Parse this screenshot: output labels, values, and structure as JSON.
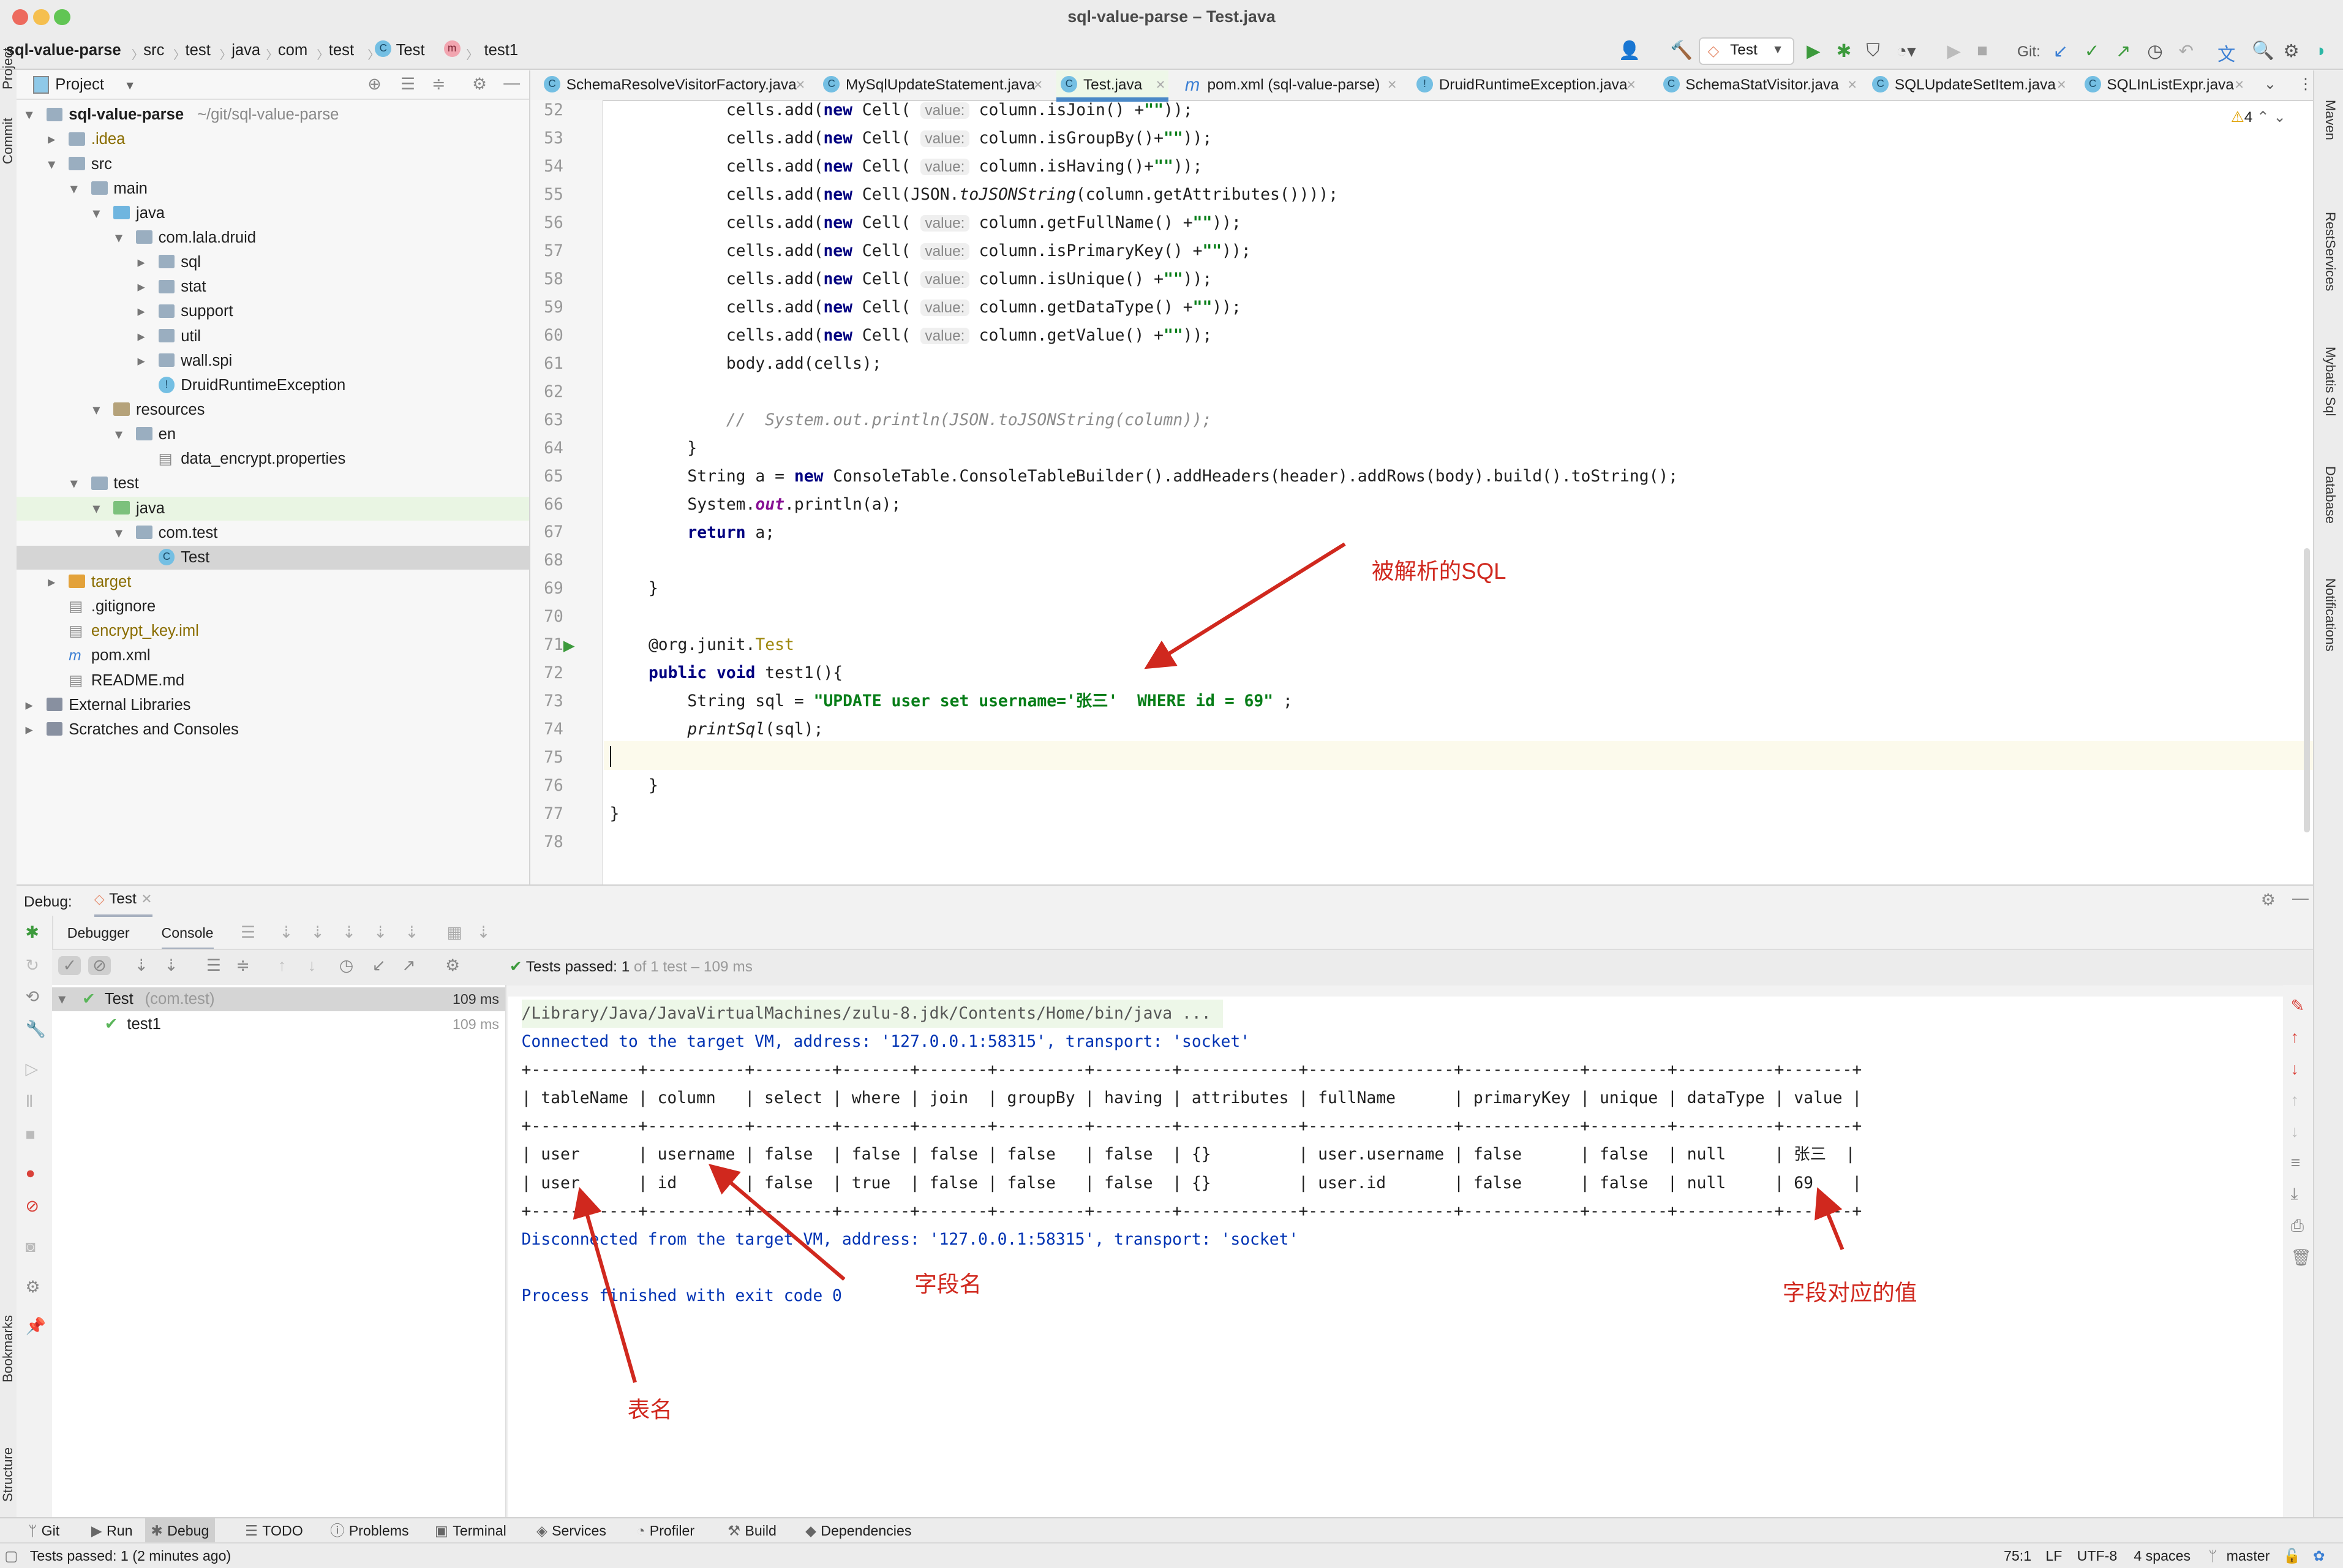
{
  "window": {
    "title": "sql-value-parse – Test.java"
  },
  "breadcrumb": [
    "sql-value-parse",
    "src",
    "test",
    "java",
    "com",
    "test",
    "Test",
    "test1"
  ],
  "toolbar": {
    "run_config": "Test",
    "git_label": "Git:",
    "icons": [
      "user-icon",
      "hammer-icon",
      "run-icon",
      "debug-icon",
      "coverage-icon",
      "profile-icon",
      "resume-icon",
      "stop-icon",
      "git-update-icon",
      "git-commit-icon",
      "git-push-icon",
      "history-icon",
      "rollback-icon",
      "translate-icon",
      "search-icon",
      "gear-icon",
      "toolbox-icon"
    ]
  },
  "left_strip": [
    "Project",
    "Commit",
    "Bookmarks",
    "Structure"
  ],
  "right_strip": [
    "Maven",
    "RestServices",
    "Mybatis Sql",
    "Database",
    "Notifications"
  ],
  "project": {
    "header": "Project",
    "tree": [
      {
        "label": "sql-value-parse",
        "extra": "~/git/sql-value-parse",
        "level": 0,
        "arrow": "open",
        "type": "module"
      },
      {
        "label": ".idea",
        "level": 1,
        "arrow": "closed",
        "type": "folder",
        "color": "#8a6d00"
      },
      {
        "label": "src",
        "level": 1,
        "arrow": "open",
        "type": "folder"
      },
      {
        "label": "main",
        "level": 2,
        "arrow": "open",
        "type": "folder"
      },
      {
        "label": "java",
        "level": 3,
        "arrow": "open",
        "type": "src"
      },
      {
        "label": "com.lala.druid",
        "level": 4,
        "arrow": "open",
        "type": "folder"
      },
      {
        "label": "sql",
        "level": 5,
        "arrow": "closed",
        "type": "folder"
      },
      {
        "label": "stat",
        "level": 5,
        "arrow": "closed",
        "type": "folder"
      },
      {
        "label": "support",
        "level": 5,
        "arrow": "closed",
        "type": "folder"
      },
      {
        "label": "util",
        "level": 5,
        "arrow": "closed",
        "type": "folder"
      },
      {
        "label": "wall.spi",
        "level": 5,
        "arrow": "closed",
        "type": "folder"
      },
      {
        "label": "DruidRuntimeException",
        "level": 5,
        "arrow": "none",
        "type": "exception"
      },
      {
        "label": "resources",
        "level": 3,
        "arrow": "open",
        "type": "res"
      },
      {
        "label": "en",
        "level": 4,
        "arrow": "open",
        "type": "folder"
      },
      {
        "label": "data_encrypt.properties",
        "level": 5,
        "arrow": "none",
        "type": "file"
      },
      {
        "label": "test",
        "level": 2,
        "arrow": "open",
        "type": "folder"
      },
      {
        "label": "java",
        "level": 3,
        "arrow": "open",
        "type": "testsrc",
        "state": "green"
      },
      {
        "label": "com.test",
        "level": 4,
        "arrow": "open",
        "type": "folder"
      },
      {
        "label": "Test",
        "level": 5,
        "arrow": "none",
        "type": "class",
        "state": "selected"
      },
      {
        "label": "target",
        "level": 1,
        "arrow": "closed",
        "type": "excluded",
        "color": "#8a6d00"
      },
      {
        "label": ".gitignore",
        "level": 1,
        "arrow": "none",
        "type": "file"
      },
      {
        "label": "encrypt_key.iml",
        "level": 1,
        "arrow": "none",
        "type": "file",
        "color": "#8a6d00"
      },
      {
        "label": "pom.xml",
        "level": 1,
        "arrow": "none",
        "type": "maven"
      },
      {
        "label": "README.md",
        "level": 1,
        "arrow": "none",
        "type": "md"
      },
      {
        "label": "External Libraries",
        "level": 0,
        "arrow": "closed",
        "type": "lib"
      },
      {
        "label": "Scratches and Consoles",
        "level": 0,
        "arrow": "closed",
        "type": "scratch"
      }
    ]
  },
  "editor": {
    "tabs": [
      {
        "label": "SchemaResolveVisitorFactory.java",
        "icon": "C"
      },
      {
        "label": "MySqlUpdateStatement.java",
        "icon": "C"
      },
      {
        "label": "Test.java",
        "icon": "C",
        "active": true
      },
      {
        "label": "pom.xml (sql-value-parse)",
        "icon": "m"
      },
      {
        "label": "DruidRuntimeException.java",
        "icon": "!"
      },
      {
        "label": "SchemaStatVisitor.java",
        "icon": "C"
      },
      {
        "label": "SQLUpdateSetItem.java",
        "icon": "C"
      },
      {
        "label": "SQLInListExpr.java",
        "icon": "C"
      }
    ],
    "warnings": "4",
    "first_line": 52,
    "current_line": 75,
    "lines": [
      [
        [
          "p",
          "            cells.add("
        ],
        [
          "kw",
          "new"
        ],
        [
          "p",
          " Cell( "
        ],
        [
          "hint",
          "value:"
        ],
        [
          "p",
          " column.isJoin() +"
        ],
        [
          "str",
          "\"\""
        ],
        [
          "p",
          "));"
        ]
      ],
      [
        [
          "p",
          "            cells.add("
        ],
        [
          "kw",
          "new"
        ],
        [
          "p",
          " Cell( "
        ],
        [
          "hint",
          "value:"
        ],
        [
          "p",
          " column.isGroupBy()+"
        ],
        [
          "str",
          "\"\""
        ],
        [
          "p",
          "));"
        ]
      ],
      [
        [
          "p",
          "            cells.add("
        ],
        [
          "kw",
          "new"
        ],
        [
          "p",
          " Cell( "
        ],
        [
          "hint",
          "value:"
        ],
        [
          "p",
          " column.isHaving()+"
        ],
        [
          "str",
          "\"\""
        ],
        [
          "p",
          "));"
        ]
      ],
      [
        [
          "p",
          "            cells.add("
        ],
        [
          "kw",
          "new"
        ],
        [
          "p",
          " Cell(JSON."
        ],
        [
          "it",
          "toJSONString"
        ],
        [
          "p",
          "(column.getAttributes())));"
        ]
      ],
      [
        [
          "p",
          "            cells.add("
        ],
        [
          "kw",
          "new"
        ],
        [
          "p",
          " Cell( "
        ],
        [
          "hint",
          "value:"
        ],
        [
          "p",
          " column.getFullName() +"
        ],
        [
          "str",
          "\"\""
        ],
        [
          "p",
          "));"
        ]
      ],
      [
        [
          "p",
          "            cells.add("
        ],
        [
          "kw",
          "new"
        ],
        [
          "p",
          " Cell( "
        ],
        [
          "hint",
          "value:"
        ],
        [
          "p",
          " column.isPrimaryKey() +"
        ],
        [
          "str",
          "\"\""
        ],
        [
          "p",
          "));"
        ]
      ],
      [
        [
          "p",
          "            cells.add("
        ],
        [
          "kw",
          "new"
        ],
        [
          "p",
          " Cell( "
        ],
        [
          "hint",
          "value:"
        ],
        [
          "p",
          " column.isUnique() +"
        ],
        [
          "str",
          "\"\""
        ],
        [
          "p",
          "));"
        ]
      ],
      [
        [
          "p",
          "            cells.add("
        ],
        [
          "kw",
          "new"
        ],
        [
          "p",
          " Cell( "
        ],
        [
          "hint",
          "value:"
        ],
        [
          "p",
          " column.getDataType() +"
        ],
        [
          "str",
          "\"\""
        ],
        [
          "p",
          "));"
        ]
      ],
      [
        [
          "p",
          "            cells.add("
        ],
        [
          "kw",
          "new"
        ],
        [
          "p",
          " Cell( "
        ],
        [
          "hint",
          "value:"
        ],
        [
          "p",
          " column.getValue() +"
        ],
        [
          "str",
          "\"\""
        ],
        [
          "p",
          "));"
        ]
      ],
      [
        [
          "p",
          "            body.add(cells);"
        ]
      ],
      [],
      [
        [
          "cm",
          "            //  System.out.println(JSON.toJSONString(column));"
        ]
      ],
      [
        [
          "p",
          "        }"
        ]
      ],
      [
        [
          "p",
          "        String a = "
        ],
        [
          "kw",
          "new"
        ],
        [
          "p",
          " ConsoleTable.ConsoleTableBuilder().addHeaders(header).addRows(body).build().toString();"
        ]
      ],
      [
        [
          "p",
          "        System."
        ],
        [
          "fld",
          "out"
        ],
        [
          "p",
          ".println(a);"
        ]
      ],
      [
        [
          "p",
          "        "
        ],
        [
          "kw",
          "return"
        ],
        [
          "p",
          " a;"
        ]
      ],
      [],
      [
        [
          "p",
          "    }"
        ]
      ],
      [],
      [
        [
          "p",
          "    @org.junit."
        ],
        [
          "ann",
          "Test"
        ]
      ],
      [
        [
          "p",
          "    "
        ],
        [
          "kw",
          "public void"
        ],
        [
          "p",
          " test1(){"
        ]
      ],
      [
        [
          "p",
          "        String sql = "
        ],
        [
          "str",
          "\"UPDATE user set username='张三'  WHERE id = 69\""
        ],
        [
          "p",
          " ;"
        ]
      ],
      [
        [
          "p",
          "        "
        ],
        [
          "it",
          "printSql"
        ],
        [
          "p",
          "(sql);"
        ]
      ],
      [],
      [
        [
          "p",
          "    }"
        ]
      ],
      [
        [
          "p",
          "}"
        ]
      ],
      []
    ]
  },
  "debug": {
    "label": "Debug:",
    "session_tab": "Test",
    "tabs": [
      "Debugger",
      "Console"
    ],
    "active_tab": "Console",
    "tests_passed_label": "Tests passed: ",
    "tests_passed_count": "1",
    "tests_passed_detail": " of 1 test – 109 ms",
    "test_tree": [
      {
        "label": "Test",
        "extra": "(com.test)",
        "time": "109 ms",
        "level": 0
      },
      {
        "label": "test1",
        "extra": "",
        "time": "109 ms",
        "level": 1
      }
    ],
    "console": [
      {
        "text": "/Library/Java/JavaVirtualMachines/zulu-8.jdk/Contents/Home/bin/java ...",
        "kind": "cmd"
      },
      {
        "text": "Connected to the target VM, address: '127.0.0.1:58315', transport: 'socket'",
        "kind": "sys"
      },
      {
        "text": "+-----------+----------+--------+-------+-------+---------+--------+------------+---------------+------------+--------+----------+-------+",
        "kind": "out"
      },
      {
        "text": "| tableName | column   | select | where | join  | groupBy | having | attributes | fullName      | primaryKey | unique | dataType | value |",
        "kind": "out"
      },
      {
        "text": "+-----------+----------+--------+-------+-------+---------+--------+------------+---------------+------------+--------+----------+-------+",
        "kind": "out"
      },
      {
        "text": "| user      | username | false  | false | false | false   | false  | {}         | user.username | false      | false  | null     | 张三  |",
        "kind": "out"
      },
      {
        "text": "| user      | id       | false  | true  | false | false   | false  | {}         | user.id       | false      | false  | null     | 69    |",
        "kind": "out"
      },
      {
        "text": "+-----------+----------+--------+-------+-------+---------+--------+------------+---------------+------------+--------+----------+-------+",
        "kind": "out"
      },
      {
        "text": "Disconnected from the target VM, address: '127.0.0.1:58315', transport: 'socket'",
        "kind": "sys"
      },
      {
        "text": "",
        "kind": "out"
      },
      {
        "text": "Process finished with exit code 0",
        "kind": "sys"
      }
    ]
  },
  "annotations": {
    "parsed_sql": "被解析的SQL",
    "field_name": "字段名",
    "table_name": "表名",
    "field_value": "字段对应的值",
    "color": "#d0281e"
  },
  "bottom_tools": [
    "Git",
    "Run",
    "Debug",
    "TODO",
    "Problems",
    "Terminal",
    "Services",
    "Profiler",
    "Build",
    "Dependencies"
  ],
  "bottom_active": "Debug",
  "status": {
    "message": "Tests passed: 1 (2 minutes ago)",
    "position": "75:1",
    "line_sep": "LF",
    "encoding": "UTF-8",
    "indent": "4 spaces",
    "branch": "master"
  }
}
